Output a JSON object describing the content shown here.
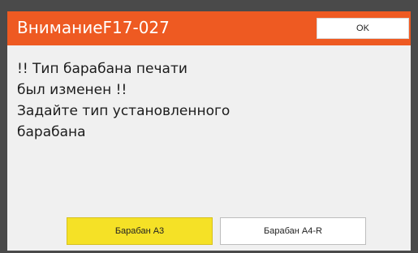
{
  "dialog": {
    "title": "ВниманиеF17-027",
    "ok_label": "OK",
    "message_lines": [
      "!! Тип барабана печати",
      "был изменен !!",
      "Задайте тип установленного",
      "барабана"
    ],
    "options": [
      {
        "label": "Барабан A3",
        "selected": true
      },
      {
        "label": "Барабан A4-R",
        "selected": false
      }
    ]
  },
  "colors": {
    "title_bar": "#EE5A22",
    "selected_button": "#F5E126",
    "dialog_bg": "#F0F0F0",
    "outer_bg": "#4A4A4A"
  }
}
